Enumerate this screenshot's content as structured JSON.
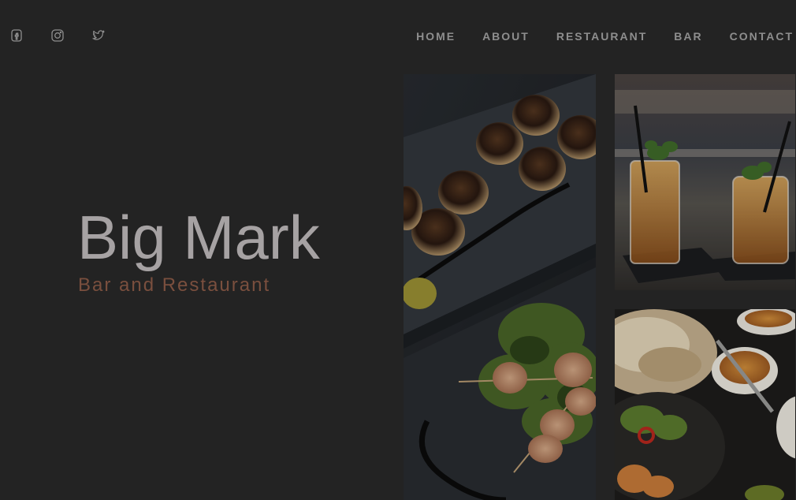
{
  "social": {
    "icons": [
      "facebook-icon",
      "instagram-icon",
      "twitter-icon"
    ]
  },
  "nav": {
    "items": [
      "HOME",
      "ABOUT",
      "RESTAURANT",
      "BAR",
      "CONTACT"
    ]
  },
  "hero": {
    "title": "Big Mark",
    "subtitle": "Bar and Restaurant"
  },
  "colors": {
    "background": "#232323",
    "title": "#a6a2a3",
    "subtitle": "#7a4f3e",
    "nav": "#8e8e8e"
  }
}
